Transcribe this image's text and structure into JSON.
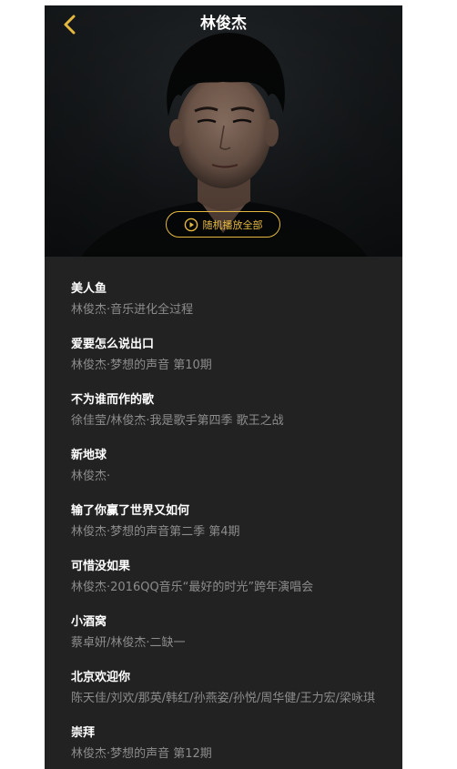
{
  "header": {
    "title": "林俊杰",
    "back_icon": "chevron-left-icon",
    "accent_color": "#e5b93f"
  },
  "hero": {
    "shuffle_label": "随机播放全部",
    "shuffle_icon": "play-circle-icon"
  },
  "songs": [
    {
      "name": "美人鱼",
      "desc": "林俊杰·音乐进化全过程"
    },
    {
      "name": "爱要怎么说出口",
      "desc": "林俊杰·梦想的声音 第10期"
    },
    {
      "name": "不为谁而作的歌",
      "desc": "徐佳莹/林俊杰·我是歌手第四季 歌王之战"
    },
    {
      "name": "新地球",
      "desc": "林俊杰·"
    },
    {
      "name": "输了你赢了世界又如何",
      "desc": "林俊杰·梦想的声音第二季 第4期"
    },
    {
      "name": "可惜没如果",
      "desc": "林俊杰·2016QQ音乐“最好的时光”跨年演唱会"
    },
    {
      "name": "小酒窝",
      "desc": "蔡卓妍/林俊杰·二缺一"
    },
    {
      "name": "北京欢迎你",
      "desc": "陈天佳/刘欢/那英/韩红/孙燕姿/孙悦/周华健/王力宏/梁咏琪"
    },
    {
      "name": "崇拜",
      "desc": "林俊杰·梦想的声音 第12期"
    }
  ]
}
